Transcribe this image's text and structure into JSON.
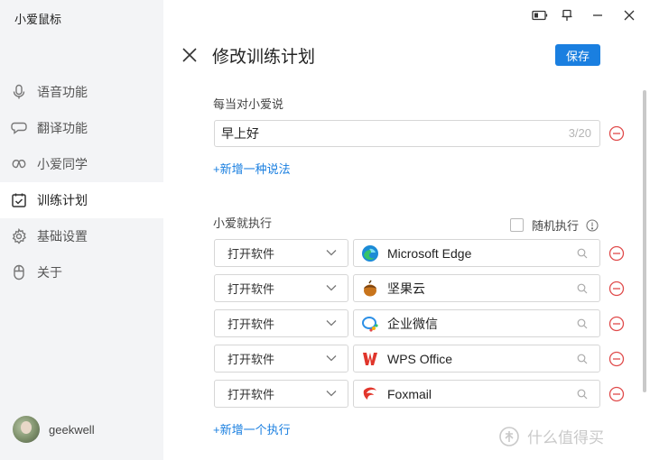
{
  "app": {
    "title": "小爱鼠标"
  },
  "sidebar": {
    "items": [
      {
        "label": "语音功能",
        "icon": "microphone-icon"
      },
      {
        "label": "翻译功能",
        "icon": "chat-bubble-icon"
      },
      {
        "label": "小爱同学",
        "icon": "infinity-icon"
      },
      {
        "label": "训练计划",
        "icon": "calendar-check-icon",
        "active": true
      },
      {
        "label": "基础设置",
        "icon": "gear-icon"
      },
      {
        "label": "关于",
        "icon": "mouse-icon"
      }
    ],
    "user": {
      "name": "geekwell"
    }
  },
  "header": {
    "title": "修改训练计划",
    "save_label": "保存"
  },
  "trigger": {
    "label": "每当对小爱说",
    "phrase": "早上好",
    "counter": "3/20",
    "add_link": "+新增一种说法"
  },
  "actions": {
    "label": "小爱就执行",
    "random_label": "随机执行",
    "random_checked": false,
    "rows": [
      {
        "type": "打开软件",
        "app": "Microsoft Edge",
        "icon": "edge-icon"
      },
      {
        "type": "打开软件",
        "app": "坚果云",
        "icon": "jianguoyun-icon"
      },
      {
        "type": "打开软件",
        "app": "企业微信",
        "icon": "wecom-icon"
      },
      {
        "type": "打开软件",
        "app": "WPS Office",
        "icon": "wps-icon"
      },
      {
        "type": "打开软件",
        "app": "Foxmail",
        "icon": "foxmail-icon"
      }
    ],
    "add_link": "+新增一个执行"
  },
  "watermark": {
    "text": "什么值得买"
  },
  "colors": {
    "accent": "#1a7fe0",
    "remove": "#e04b4b",
    "sidebar_bg": "#f3f4f6"
  }
}
